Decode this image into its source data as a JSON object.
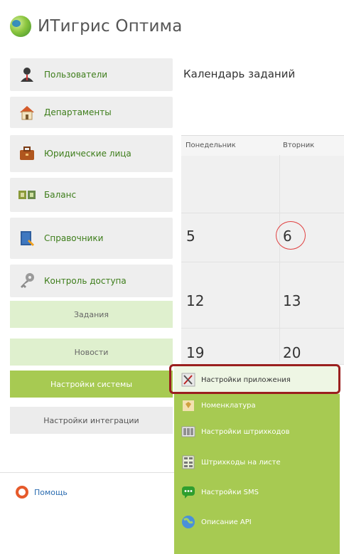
{
  "app": {
    "title": "ИТигрис Оптима"
  },
  "sidebar": {
    "items": [
      {
        "label": "Пользователи",
        "icon": "user-icon"
      },
      {
        "label": "Департаменты",
        "icon": "house-icon"
      },
      {
        "label": "Юридические лица",
        "icon": "briefcase-icon"
      },
      {
        "label": "Баланс",
        "icon": "cash-icon"
      },
      {
        "label": "Справочники",
        "icon": "book-icon"
      },
      {
        "label": "Контроль доступа",
        "icon": "key-icon"
      }
    ],
    "sub_items": [
      {
        "label": "Задания"
      },
      {
        "label": "Новости"
      },
      {
        "label": "Настройки системы",
        "active": true
      },
      {
        "label": "Настройки интеграции"
      }
    ],
    "help": {
      "label": "Помощь",
      "icon": "lifebuoy-icon"
    }
  },
  "calendar": {
    "title": "Календарь заданий",
    "headers": [
      "Понедельник",
      "Вторник"
    ],
    "rows": [
      [
        "",
        ""
      ],
      [
        "5",
        "6"
      ],
      [
        "12",
        "13"
      ],
      [
        "19",
        "20"
      ]
    ],
    "today": "6"
  },
  "dropdown": {
    "items": [
      {
        "label": "Настройки приложения",
        "icon": "settings-tools-icon"
      },
      {
        "label": "Номенклатура",
        "icon": "catalog-icon"
      },
      {
        "label": "Настройки штрихкодов",
        "icon": "barcode-scanner-icon"
      },
      {
        "label": "Штрихкоды на листе",
        "icon": "barcode-sheet-icon"
      },
      {
        "label": "Настройки SMS",
        "icon": "sms-icon"
      },
      {
        "label": "Описание API",
        "icon": "globe-icon"
      }
    ]
  },
  "colors": {
    "accent_green": "#a7ca52",
    "light_green": "#dff0ce",
    "link_green": "#3d7d1a",
    "highlight_red": "#9a1f1f"
  }
}
